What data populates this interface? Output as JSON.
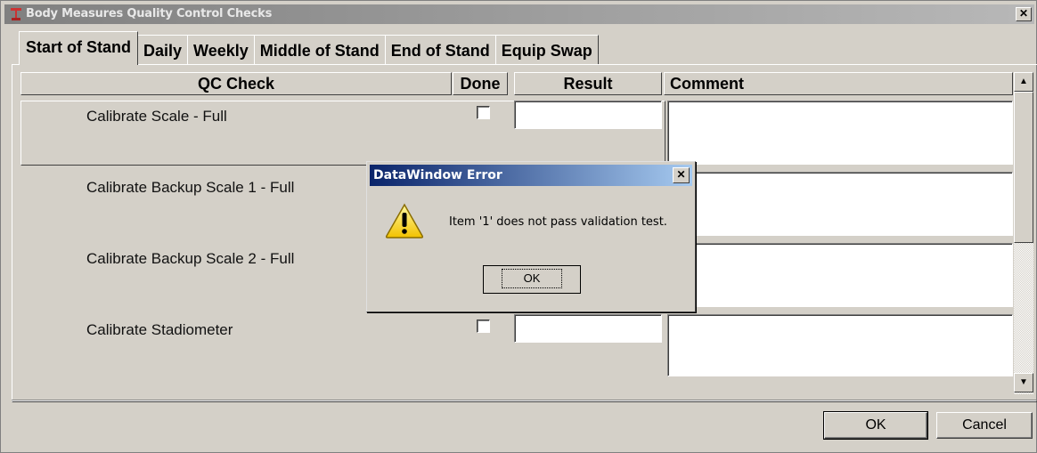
{
  "window": {
    "title": "Body Measures Quality Control Checks",
    "close_glyph": "✕"
  },
  "tabs": [
    {
      "label": "Start of Stand",
      "active": true
    },
    {
      "label": "Daily"
    },
    {
      "label": "Weekly"
    },
    {
      "label": "Middle of Stand"
    },
    {
      "label": "End of Stand"
    },
    {
      "label": "Equip Swap"
    }
  ],
  "grid": {
    "headers": {
      "qc_check": "QC Check",
      "done": "Done",
      "result": "Result",
      "comment": "Comment"
    },
    "rows": [
      {
        "label": "Calibrate Scale - Full",
        "done": false,
        "result": "",
        "comment": ""
      },
      {
        "label": "Calibrate Backup Scale 1 - Full",
        "done": false,
        "result": "",
        "comment": ""
      },
      {
        "label": "Calibrate Backup Scale 2 - Full",
        "done": false,
        "result": "",
        "comment": ""
      },
      {
        "label": "Calibrate Stadiometer",
        "done": false,
        "result": "",
        "comment": ""
      }
    ]
  },
  "buttons": {
    "ok": "OK",
    "cancel": "Cancel"
  },
  "dialog": {
    "title": "DataWindow Error",
    "message": "Item '1' does not pass validation test.",
    "ok": "OK",
    "close_glyph": "✕",
    "icon": "warning-icon"
  },
  "colors": {
    "dialog_title_start": "#0a246a",
    "dialog_title_end": "#a6caf0",
    "window_face": "#d4d0c8",
    "inactive_title": "#808080"
  }
}
